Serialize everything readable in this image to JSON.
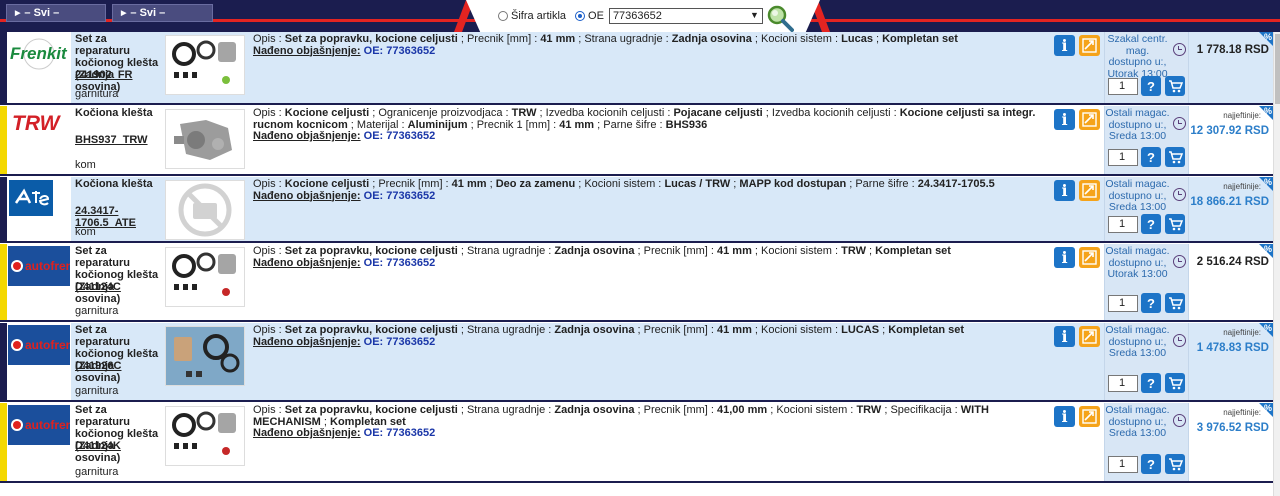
{
  "header": {
    "category_1": "– Svi –",
    "category_2": "– Svi –",
    "search_mode_article": "Šifra artikla",
    "search_mode_oe": "OE",
    "search_value": "77363652"
  },
  "colors": {
    "header_bg": "#1b1d4f",
    "accent_red": "#e42421",
    "action_blue": "#1d74c7",
    "stock_blue": "#2c6aad"
  },
  "labels": {
    "desc_prefix": "Opis :",
    "found_label": "Nađeno objašnjenje:",
    "cheapest": "najjeftinije:",
    "percent": "%",
    "help": "?"
  },
  "rows": [
    {
      "brand": "Frenkit",
      "brand_color": "#1a8a3e",
      "stripe": "#1b1d4f",
      "bg": "#d8e8f8",
      "name": "Set za reparaturu kočionog klešta (Zadnja osovina)",
      "code": "241902_FR",
      "unit": "garnitura",
      "desc_html": "Opis : <b>Set za popravku, kocione celjusti</b> ; Precnik [mm] : <b>41 mm</b> ; Strana ugradnje : <b>Zadnja osovina</b> ; Kocioni sistem : <b>Lucas</b> ; <b>Kompletan set</b>",
      "oe": "OE: 77363652",
      "stock": "Szakal centr. mag. dostupno u:, Utorak 13:00",
      "qty": "1",
      "price_label": "",
      "price": "1 778.18 RSD"
    },
    {
      "brand": "TRW",
      "brand_color": "#d32027",
      "stripe": "#f4d800",
      "bg": "#ffffff",
      "name": "Kočiona klešta",
      "code": "BHS937_TRW",
      "unit": "kom",
      "desc_html": "Opis : <b>Kocione celjusti</b> ; Ogranicenje proizvodjaca : <b>TRW</b> ; Izvedba kocionih celjusti : <b>Pojacane celjusti</b> ; Izvedba kocionih celjusti : <b>Kocione celjusti sa integr. rucnom kocnicom</b> ; Materijal : <b>Aluminijum</b> ; Precnik 1 [mm] : <b>41 mm</b> ; Parne šifre : <b>BHS936</b>",
      "oe": "OE: 77363652",
      "stock": "Ostali magac. dostupno u:, Sreda 13:00",
      "qty": "1",
      "price_label": "najjeftinije:",
      "price": "12 307.92 RSD"
    },
    {
      "brand": "ATE",
      "brand_color": "#0b5ca8",
      "stripe": "#1b1d4f",
      "bg": "#d8e8f8",
      "name": "Kočiona klešta",
      "code": "24.3417-1706.5_ATE",
      "unit": "kom",
      "desc_html": "Opis : <b>Kocione celjusti</b> ; Precnik [mm] : <b>41 mm</b> ; <b>Deo za zamenu</b> ; Kocioni sistem : <b>Lucas / TRW</b> ; <b>MAPP kod dostupan</b> ; Parne šifre : <b>24.3417-1705.5</b>",
      "oe": "OE: 77363652",
      "stock": "Ostali magac. dostupno u:, Sreda 13:00",
      "qty": "1",
      "price_label": "najjeftinije:",
      "price": "18 866.21 RSD"
    },
    {
      "brand": "autofren",
      "brand_color": "#e0211e",
      "stripe": "#f4d800",
      "bg": "#ffffff",
      "name": "Set za reparaturu kočionog klešta (Zadnja osovina)",
      "code": "D41124C",
      "unit": "garnitura",
      "desc_html": "Opis : <b>Set za popravku, kocione celjusti</b> ; Strana ugradnje : <b>Zadnja osovina</b> ; Precnik [mm] : <b>41 mm</b> ; Kocioni sistem : <b>TRW</b> ; <b>Kompletan set</b>",
      "oe": "OE: 77363652",
      "stock": "Ostali magac. dostupno u:, Utorak 13:00",
      "qty": "1",
      "price_label": "",
      "price": "2 516.24 RSD"
    },
    {
      "brand": "autofren",
      "brand_color": "#e0211e",
      "stripe": "#1b1d4f",
      "bg": "#d8e8f8",
      "name": "Set za reparaturu kočionog klešta (Zadnja osovina)",
      "code": "D41926C",
      "unit": "garnitura",
      "desc_html": "Opis : <b>Set za popravku, kocione celjusti</b> ; Strana ugradnje : <b>Zadnja osovina</b> ; Precnik [mm] : <b>41 mm</b> ; Kocioni sistem : <b>LUCAS</b> ; <b>Kompletan set</b>",
      "oe": "OE: 77363652",
      "stock": "Ostali magac. dostupno u:, Sreda 13:00",
      "qty": "1",
      "price_label": "najjeftinije:",
      "price": "1 478.83 RSD"
    },
    {
      "brand": "autofren",
      "brand_color": "#e0211e",
      "stripe": "#f4d800",
      "bg": "#ffffff",
      "name": "Set za reparaturu kočionog klešta (Zadnja osovina)",
      "code": "D41124K",
      "unit": "garnitura",
      "desc_html": "Opis : <b>Set za popravku, kocione celjusti</b> ; Strana ugradnje : <b>Zadnja osovina</b> ; Precnik [mm] : <b>41,00 mm</b> ; Kocioni sistem : <b>TRW</b> ; Specifikacija : <b>WITH MECHANISM</b> ; <b>Kompletan set</b>",
      "oe": "OE: 77363652",
      "stock": "Ostali magac. dostupno u:, Sreda 13:00",
      "qty": "1",
      "price_label": "najjeftinije:",
      "price": "3 976.52 RSD"
    }
  ]
}
